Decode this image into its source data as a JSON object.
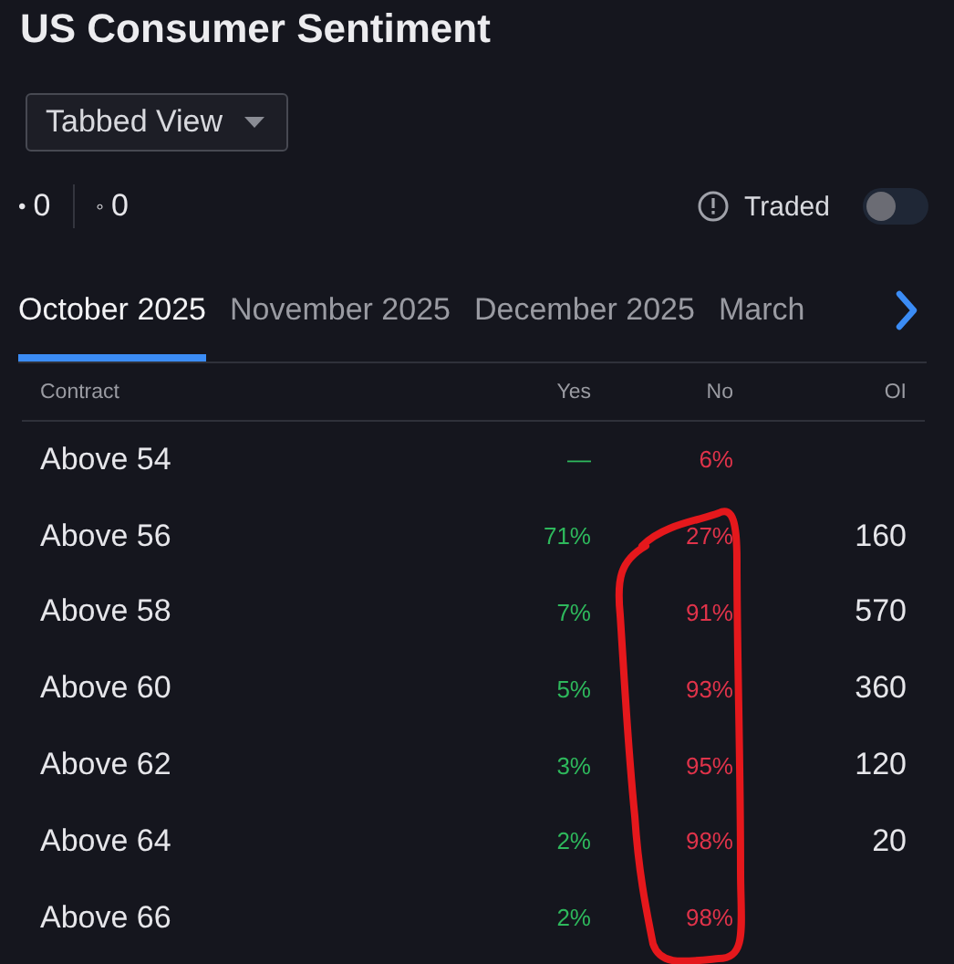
{
  "title": "US Consumer Sentiment",
  "view_select": {
    "value": "Tabbed View"
  },
  "counters": [
    {
      "bullet": "•",
      "value": "0"
    },
    {
      "bullet": "◦",
      "value": "0"
    }
  ],
  "traded": {
    "label": "Traded",
    "on": false
  },
  "tabs": [
    {
      "label": "October 2025",
      "selected": true
    },
    {
      "label": "November 2025",
      "selected": false
    },
    {
      "label": "December 2025",
      "selected": false
    },
    {
      "label": "March",
      "selected": false
    }
  ],
  "table": {
    "columns": [
      "Contract",
      "Yes",
      "No",
      "OI"
    ],
    "rows": [
      {
        "contract": "Above 54",
        "yes": "—",
        "no": "6%"
      },
      {
        "contract": "Above 56",
        "yes": "71%",
        "no": "27%",
        "oi": "160"
      },
      {
        "contract": "Above 58",
        "yes": "7%",
        "no": "91%",
        "oi": "570"
      },
      {
        "contract": "Above 60",
        "yes": "5%",
        "no": "93%",
        "oi": "360"
      },
      {
        "contract": "Above 62",
        "yes": "3%",
        "no": "95%",
        "oi": "120"
      },
      {
        "contract": "Above 64",
        "yes": "2%",
        "no": "98%",
        "oi": "20"
      },
      {
        "contract": "Above 66",
        "yes": "2%",
        "no": "98%"
      }
    ]
  },
  "annotation": {
    "kind": "loop"
  }
}
